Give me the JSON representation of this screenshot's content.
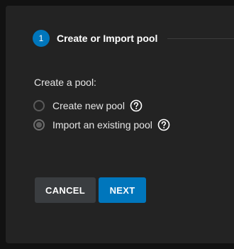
{
  "stepper": {
    "step_number": "1",
    "step_label": "Create or Import pool"
  },
  "form": {
    "section_label": "Create a pool:",
    "options": [
      {
        "label": "Create new pool",
        "selected": false
      },
      {
        "label": "Import an existing pool",
        "selected": true
      }
    ]
  },
  "actions": {
    "cancel_label": "CANCEL",
    "next_label": "NEXT"
  },
  "colors": {
    "accent": "#0076bc",
    "background": "#121212",
    "panel": "#232323"
  },
  "icons": {
    "help": "help-circle-icon"
  }
}
